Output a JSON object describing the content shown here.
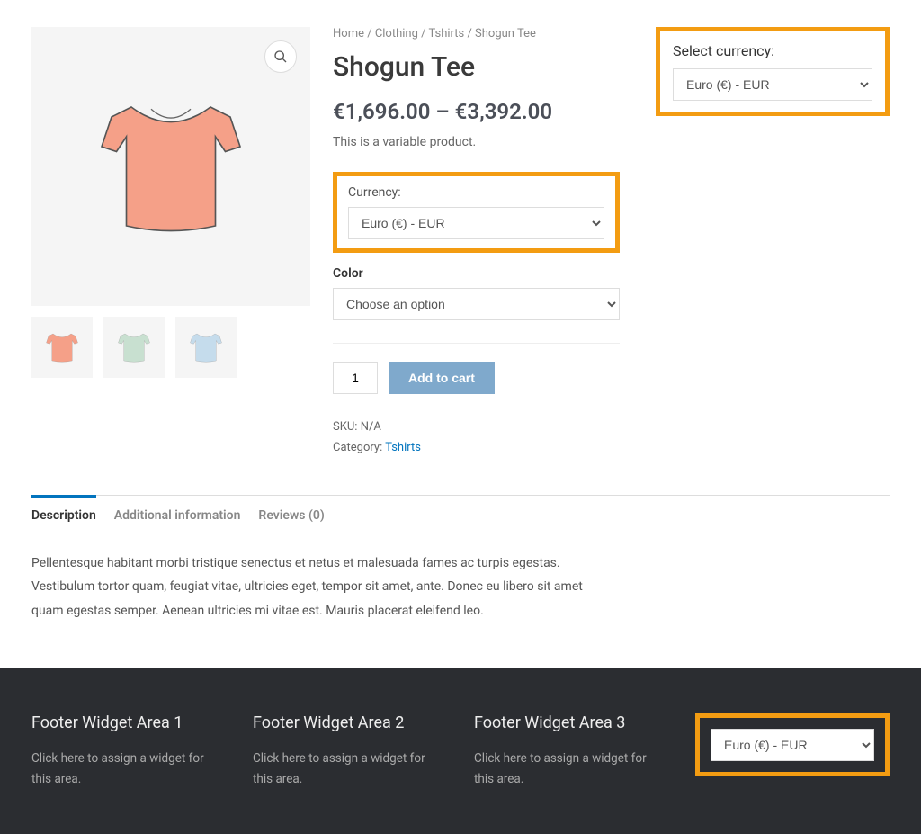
{
  "breadcrumb": [
    "Home",
    "Clothing",
    "Tshirts",
    "Shogun Tee"
  ],
  "product": {
    "title": "Shogun Tee",
    "price_low": "€1,696.00",
    "price_sep": "–",
    "price_high": "€3,392.00",
    "short_desc": "This is a variable product.",
    "sku_label": "SKU:",
    "sku_value": "N/A",
    "category_label": "Category:",
    "category_value": "Tshirts"
  },
  "currency": {
    "label": "Currency:",
    "selected": "Euro (€) - EUR"
  },
  "color": {
    "label": "Color",
    "placeholder": "Choose an option"
  },
  "cart": {
    "qty": "1",
    "add_label": "Add to cart"
  },
  "tabs": {
    "desc": "Description",
    "addl": "Additional information",
    "reviews": "Reviews (0)"
  },
  "tab_content": "Pellentesque habitant morbi tristique senectus et netus et malesuada fames ac turpis egestas. Vestibulum tortor quam, feugiat vitae, ultricies eget, tempor sit amet, ante. Donec eu libero sit amet quam egestas semper. Aenean ultricies mi vitae est. Mauris placerat eleifend leo.",
  "sidebar": {
    "label": "Select currency:",
    "selected": "Euro (€) - EUR"
  },
  "footer": {
    "cols": [
      {
        "title": "Footer Widget Area 1",
        "text": "Click here to assign a widget for this area."
      },
      {
        "title": "Footer Widget Area 2",
        "text": "Click here to assign a widget for this area."
      },
      {
        "title": "Footer Widget Area 3",
        "text": "Click here to assign a widget for this area."
      }
    ],
    "currency_selected": "Euro (€) - EUR"
  }
}
